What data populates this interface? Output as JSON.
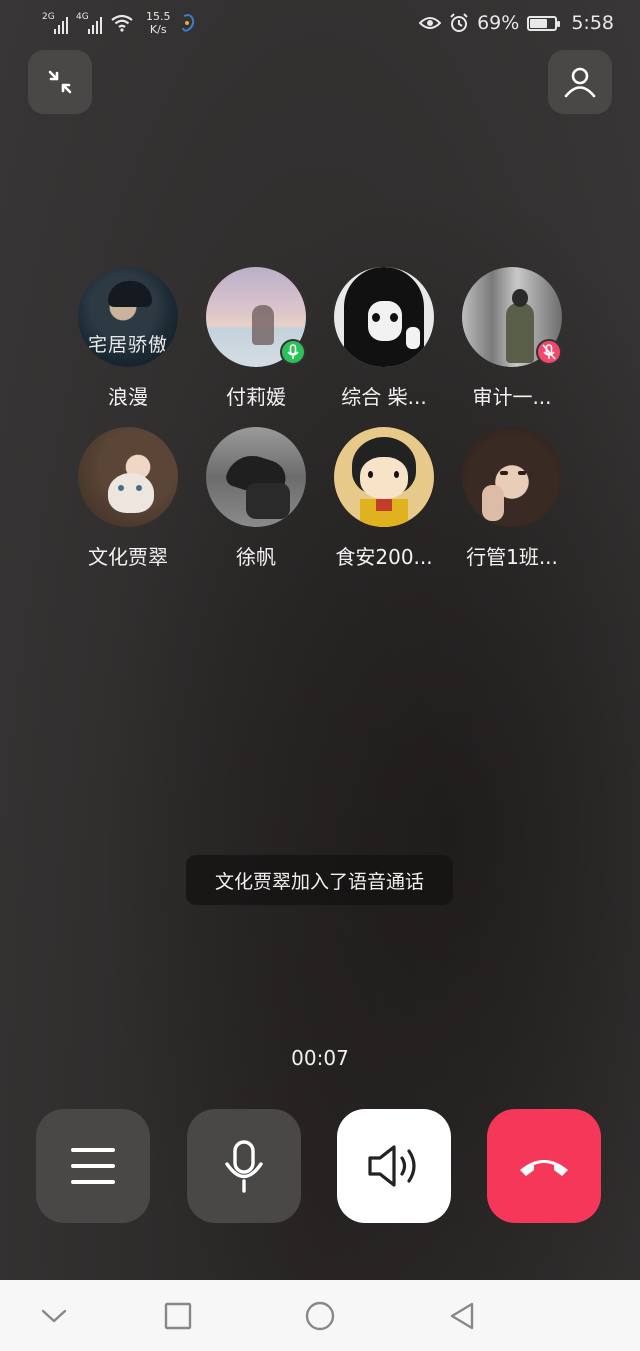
{
  "status_bar": {
    "signal1_label": "2G",
    "signal2_label": "4G",
    "speed_value": "15.5",
    "speed_unit": "K/s",
    "battery_percent": "69%",
    "battery_level": 0.69,
    "time": "5:58"
  },
  "top": {
    "minimize_icon": "minimize-arrows-icon",
    "contacts_icon": "person-icon"
  },
  "participants": [
    {
      "name": "浪漫",
      "overlay_text": "宅居骄傲",
      "mic": "none"
    },
    {
      "name": "付莉媛",
      "mic": "speaking"
    },
    {
      "name": "综合 柴...",
      "mic": "none"
    },
    {
      "name": "审计一...",
      "mic": "muted"
    },
    {
      "name": "文化贾翠",
      "mic": "none"
    },
    {
      "name": "徐帆",
      "mic": "none"
    },
    {
      "name": "食安200...",
      "mic": "none"
    },
    {
      "name": "行管1班...",
      "mic": "none"
    }
  ],
  "toast": "文化贾翠加入了语音通话",
  "timer": "00:07",
  "controls": {
    "menu_icon": "menu-icon",
    "mic_icon": "microphone-icon",
    "speaker_icon": "speaker-icon",
    "hangup_icon": "hang-up-icon"
  },
  "colors": {
    "speaking_badge": "#2bc25c",
    "muted_badge": "#f2486a",
    "hangup": "#f5385a",
    "button_dark": "#4a4747"
  }
}
